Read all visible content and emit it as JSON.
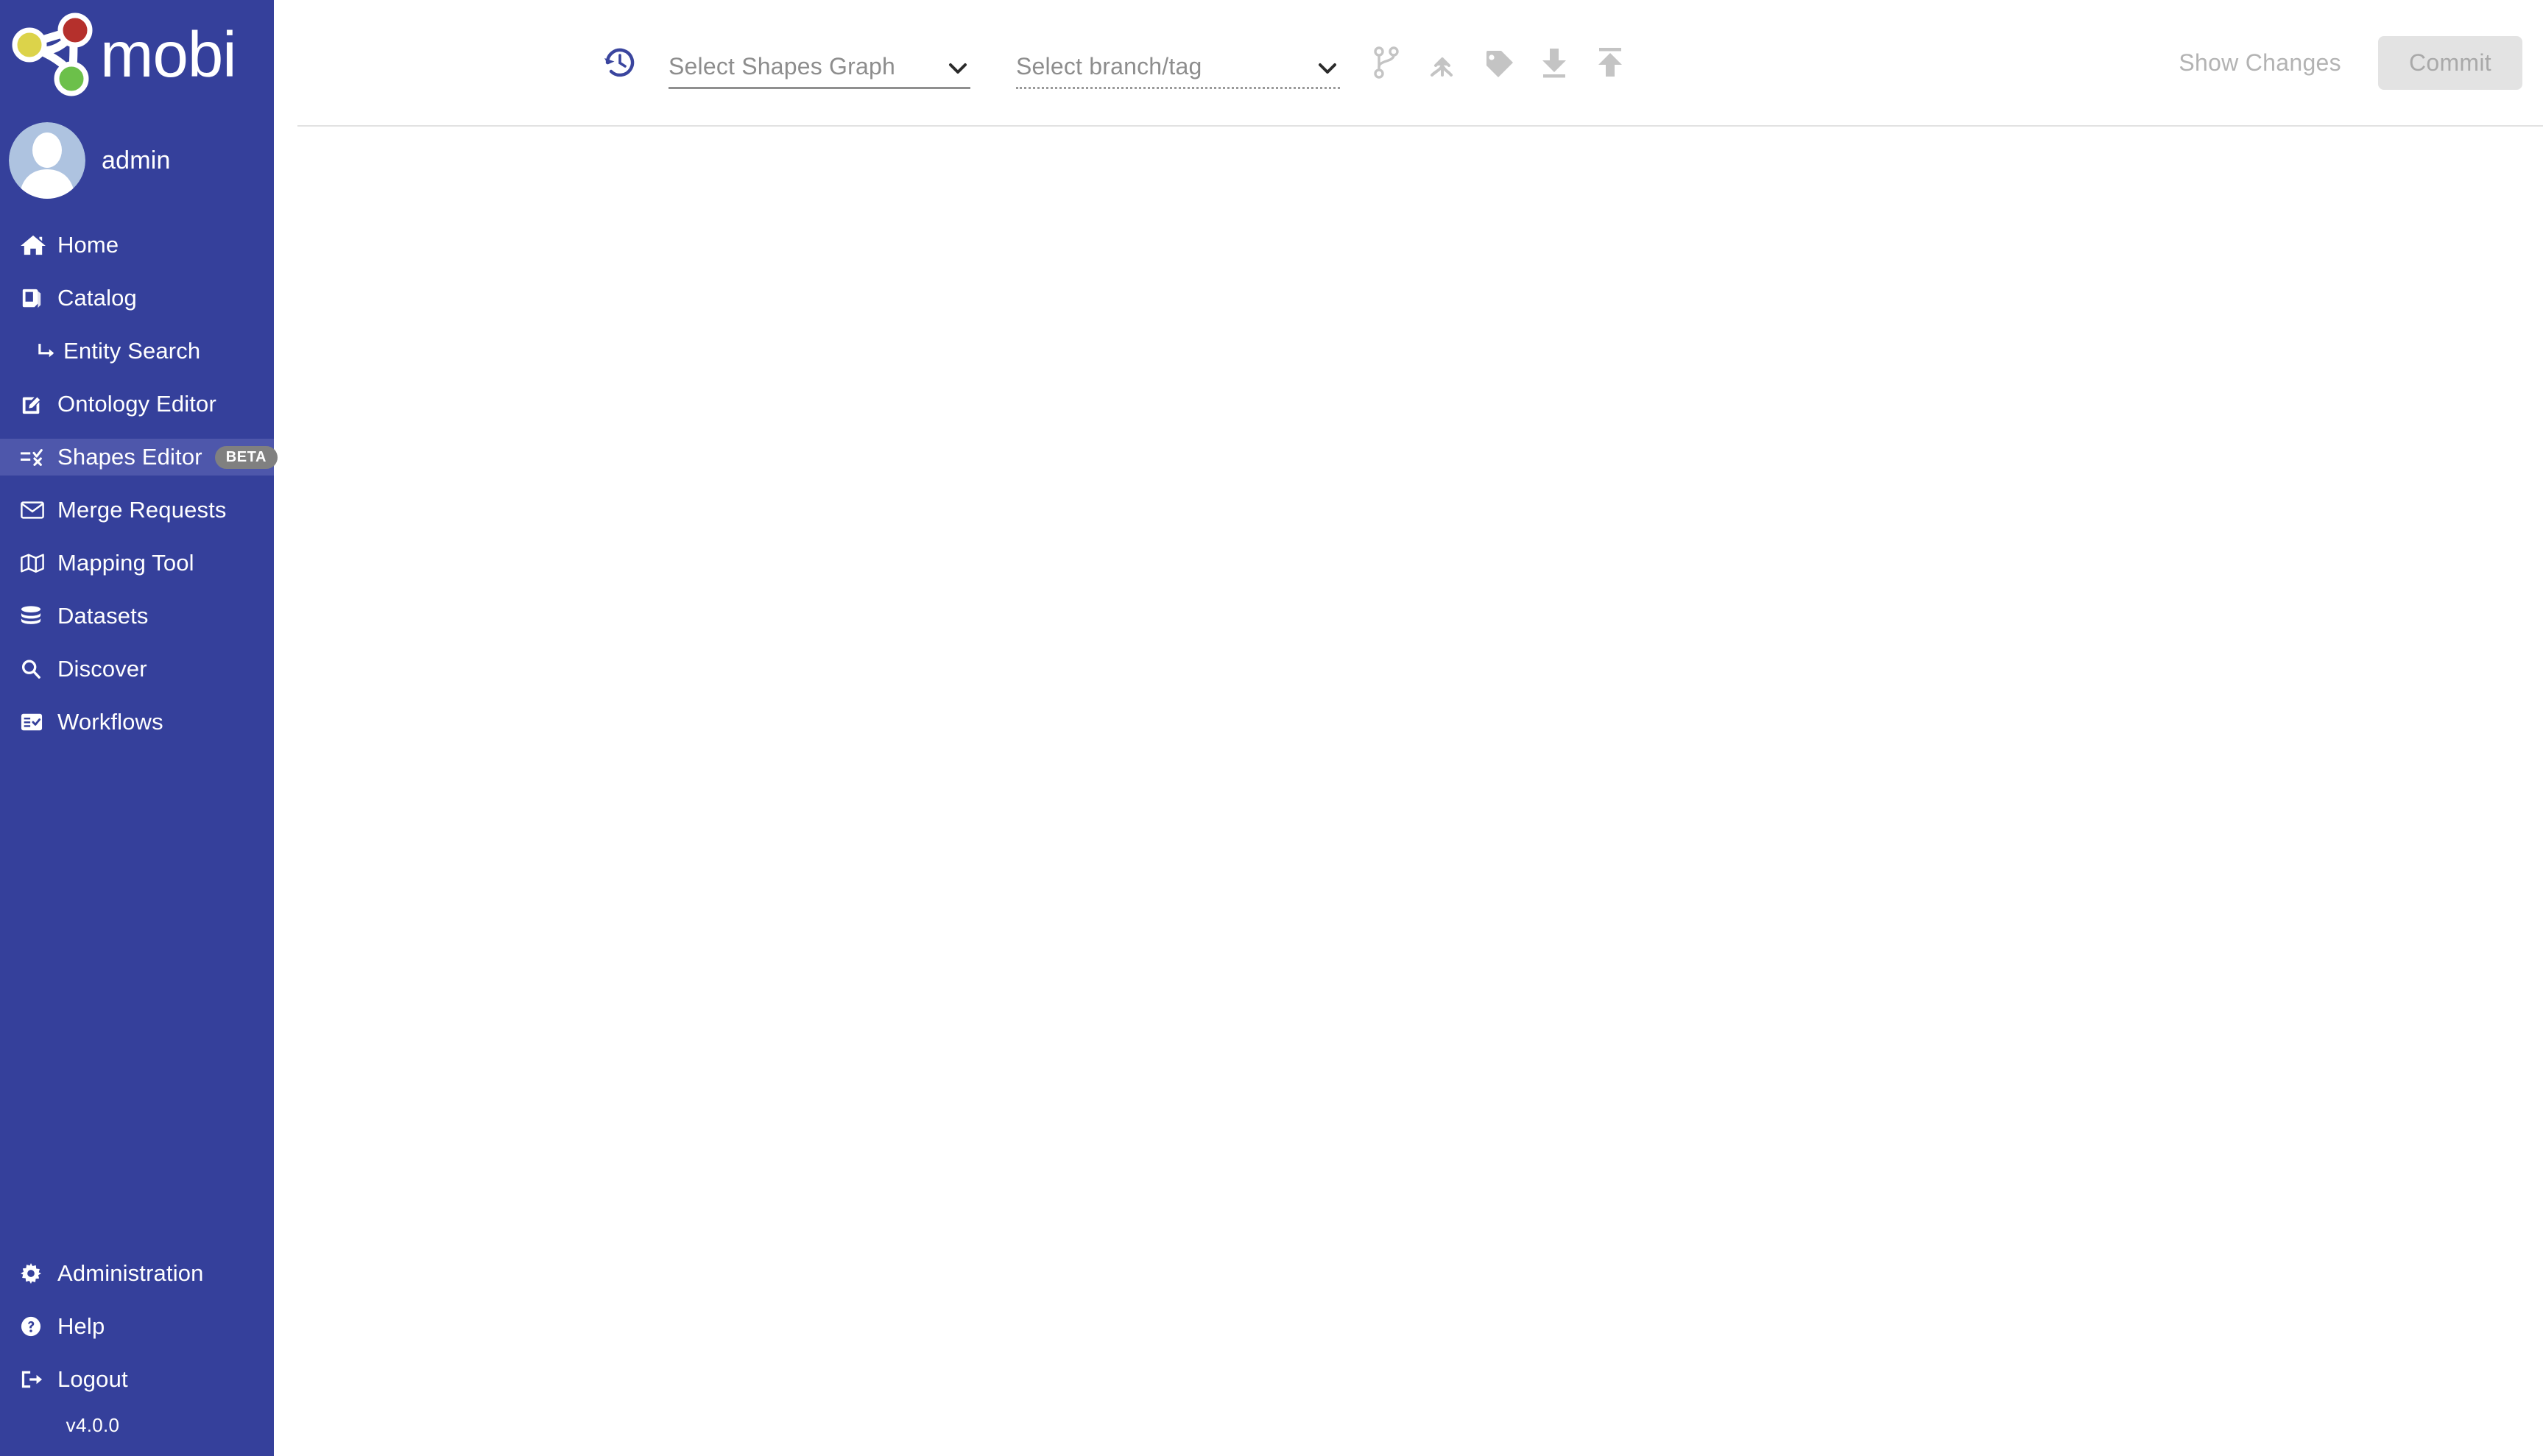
{
  "app": {
    "brand_name": "mobi",
    "version": "v4.0.0",
    "brand_color": "#35409b",
    "active_item_color": "#4e57ab",
    "logo_node_colors": {
      "red": "#b5302c",
      "yellow": "#dcd34a",
      "green": "#6cc04a"
    }
  },
  "user": {
    "name": "admin",
    "avatar_icon": "user-avatar-icon"
  },
  "sidebar": {
    "items": [
      {
        "label": "Home",
        "icon": "home-icon",
        "active": false,
        "sub": false
      },
      {
        "label": "Catalog",
        "icon": "book-icon",
        "active": false,
        "sub": false
      },
      {
        "label": "Entity Search",
        "icon": "arrow-turn-down-right-icon",
        "active": false,
        "sub": true
      },
      {
        "label": "Ontology Editor",
        "icon": "pencil-square-icon",
        "active": false,
        "sub": false
      },
      {
        "label": "Shapes Editor",
        "icon": "shapes-validate-icon",
        "active": true,
        "sub": false,
        "badge": "BETA"
      },
      {
        "label": "Merge Requests",
        "icon": "envelope-icon",
        "active": false,
        "sub": false
      },
      {
        "label": "Mapping Tool",
        "icon": "map-icon",
        "active": false,
        "sub": false
      },
      {
        "label": "Datasets",
        "icon": "database-icon",
        "active": false,
        "sub": false
      },
      {
        "label": "Discover",
        "icon": "search-icon",
        "active": false,
        "sub": false
      },
      {
        "label": "Workflows",
        "icon": "list-check-icon",
        "active": false,
        "sub": false
      }
    ],
    "bottom_items": [
      {
        "label": "Administration",
        "icon": "gear-icon"
      },
      {
        "label": "Help",
        "icon": "question-circle-icon"
      },
      {
        "label": "Logout",
        "icon": "sign-out-icon"
      }
    ]
  },
  "toolbar": {
    "history_icon": "history-clock-icon",
    "shapes_graph_select": {
      "placeholder": "Select Shapes Graph",
      "value": "",
      "disabled": false,
      "chevron_icon": "chevron-down-icon"
    },
    "branch_select": {
      "placeholder": "Select branch/tag",
      "value": "",
      "disabled": true,
      "chevron_icon": "chevron-down-icon"
    },
    "actions": [
      {
        "name": "create-branch",
        "icon": "code-branch-icon",
        "disabled": true
      },
      {
        "name": "merge-branches",
        "icon": "arrow-merge-icon",
        "disabled": true
      },
      {
        "name": "create-tag",
        "icon": "tag-icon",
        "disabled": true
      },
      {
        "name": "download",
        "icon": "download-icon",
        "disabled": true
      },
      {
        "name": "upload",
        "icon": "upload-icon",
        "disabled": true
      }
    ],
    "show_changes_label": "Show Changes",
    "commit_label": "Commit"
  }
}
